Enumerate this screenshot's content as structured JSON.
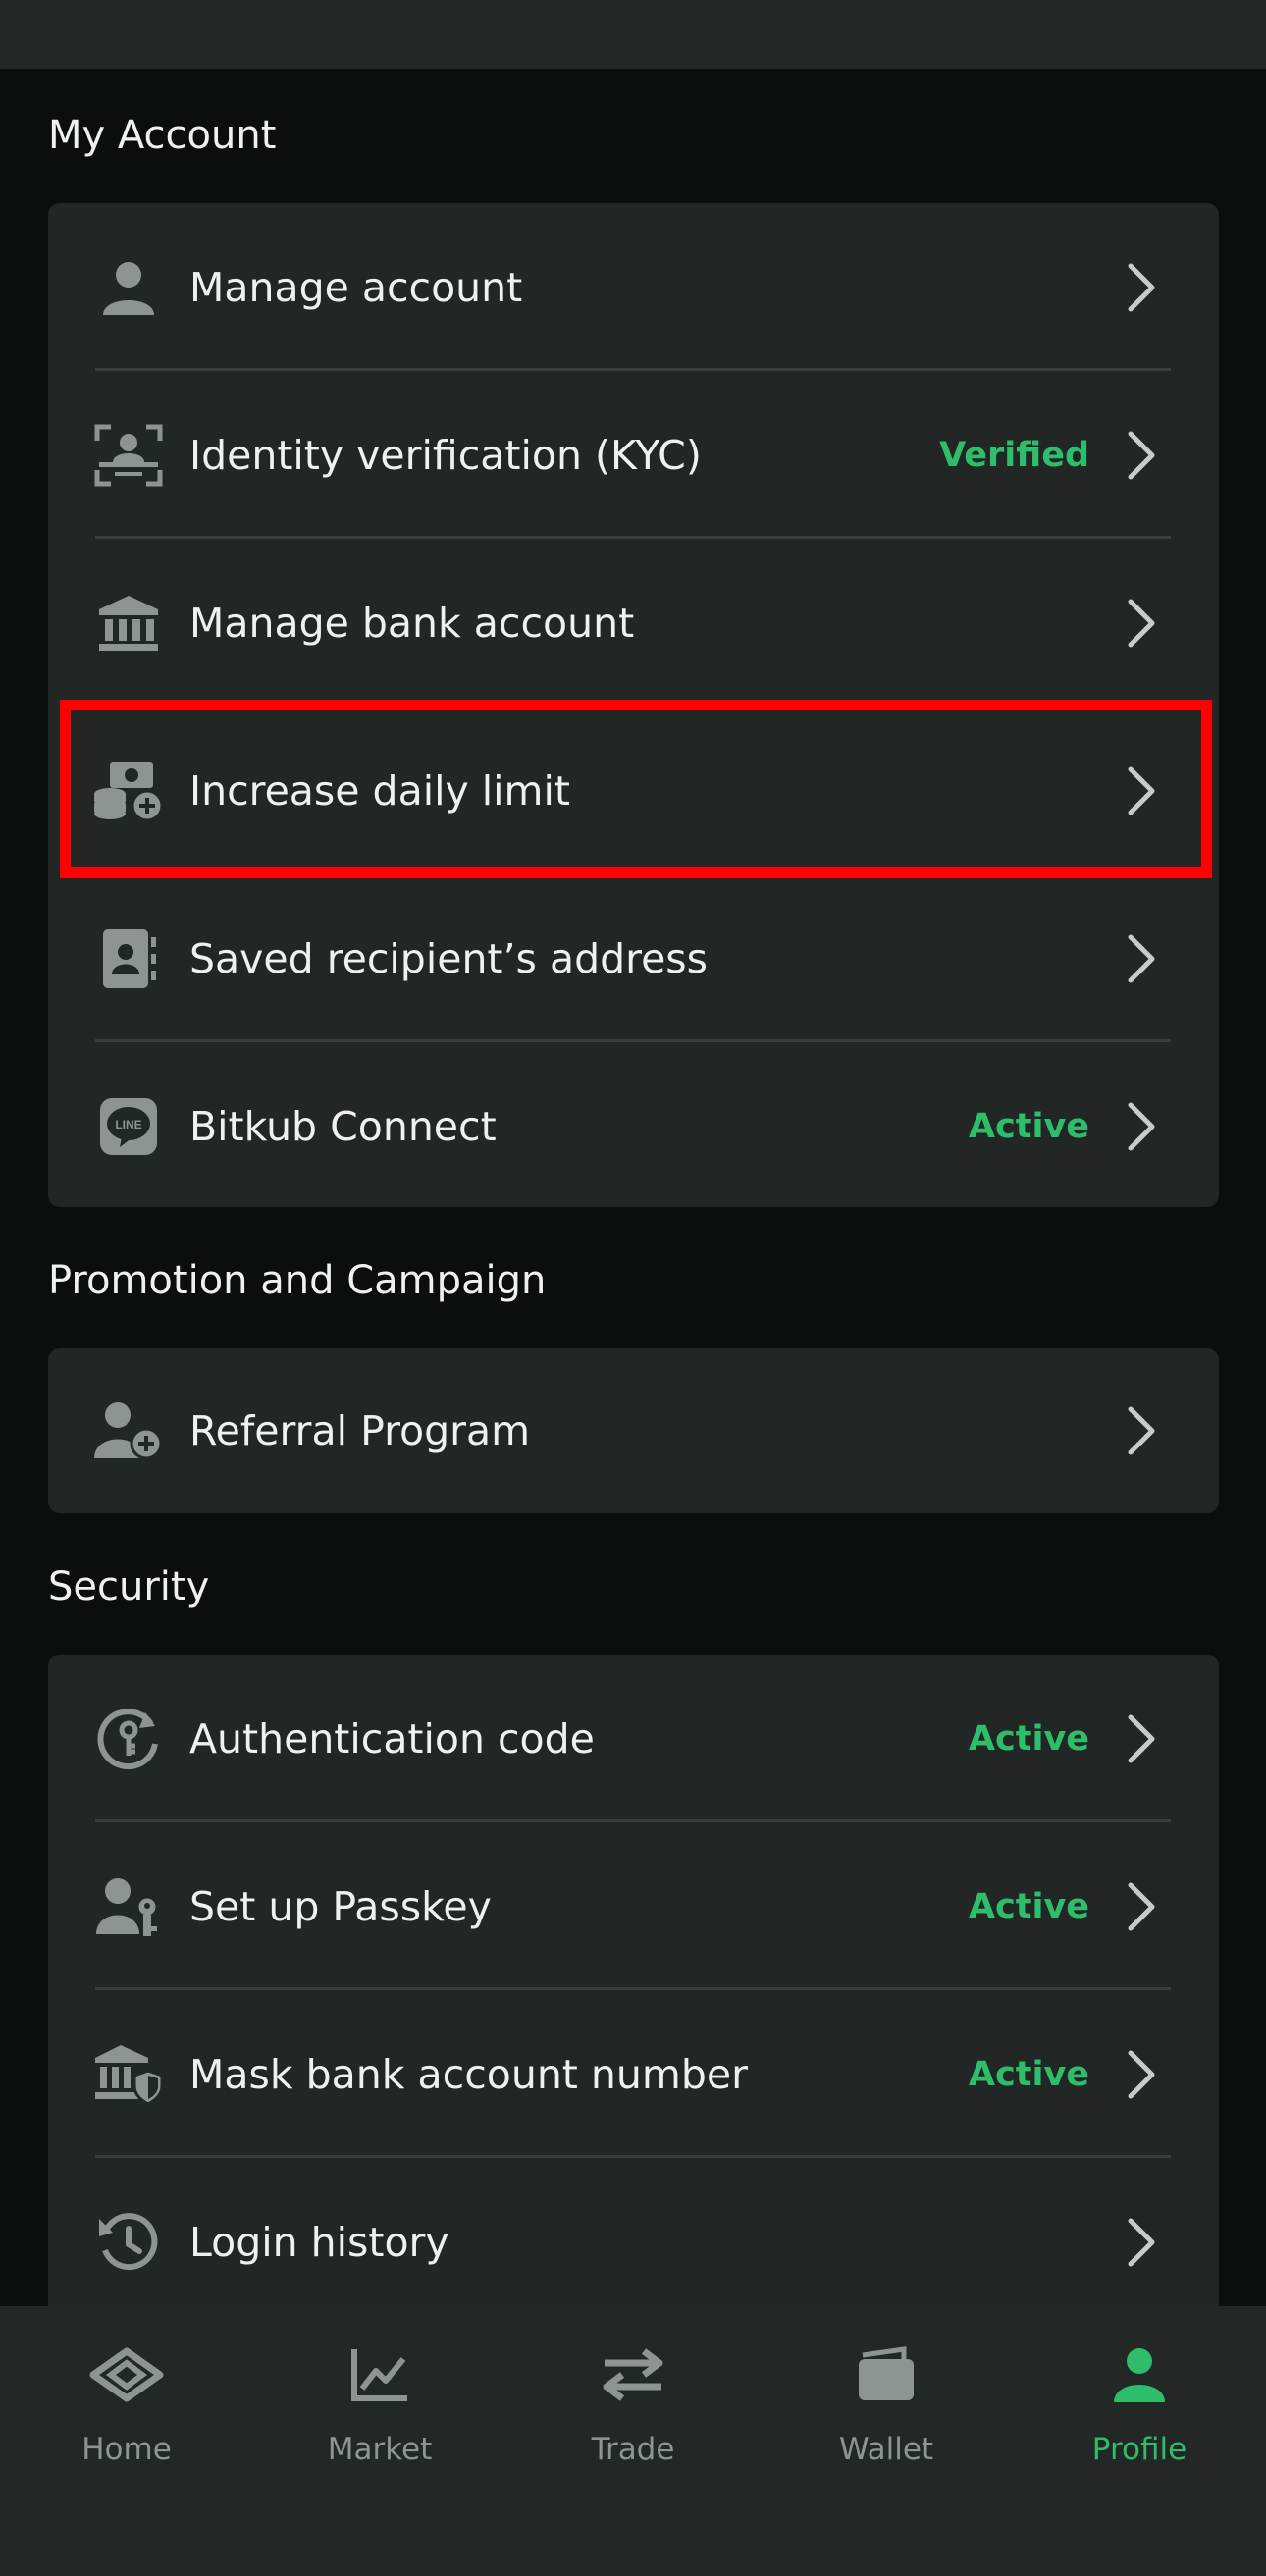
{
  "sections": {
    "my_account": "My Account",
    "promotion": "Promotion and Campaign",
    "security": "Security"
  },
  "account_items": [
    {
      "label": "Manage account",
      "icon": "person-icon",
      "status": ""
    },
    {
      "label": "Identity verification (KYC)",
      "icon": "face-scan-icon",
      "status": "Verified"
    },
    {
      "label": "Manage bank account",
      "icon": "bank-icon",
      "status": ""
    },
    {
      "label": "Increase daily limit",
      "icon": "money-plus-icon",
      "status": ""
    },
    {
      "label": "Saved recipient’s address",
      "icon": "contact-book-icon",
      "status": ""
    },
    {
      "label": "Bitkub Connect",
      "icon": "line-icon",
      "status": "Active"
    }
  ],
  "promotion_items": [
    {
      "label": "Referral Program",
      "icon": "person-plus-icon",
      "status": ""
    }
  ],
  "security_items": [
    {
      "label": "Authentication code",
      "icon": "key-refresh-icon",
      "status": "Active"
    },
    {
      "label": "Set up Passkey",
      "icon": "person-key-icon",
      "status": "Active"
    },
    {
      "label": "Mask bank account number",
      "icon": "bank-shield-icon",
      "status": "Active"
    },
    {
      "label": "Login history",
      "icon": "history-icon",
      "status": ""
    }
  ],
  "nav": [
    {
      "label": "Home",
      "icon": "home-icon",
      "active": false
    },
    {
      "label": "Market",
      "icon": "chart-icon",
      "active": false
    },
    {
      "label": "Trade",
      "icon": "swap-icon",
      "active": false
    },
    {
      "label": "Wallet",
      "icon": "wallet-icon",
      "active": false
    },
    {
      "label": "Profile",
      "icon": "profile-icon",
      "active": true
    }
  ],
  "colors": {
    "accent": "#2ebd6b",
    "highlight": "#ff0000",
    "card": "#222624",
    "background": "#0b0e0d"
  }
}
